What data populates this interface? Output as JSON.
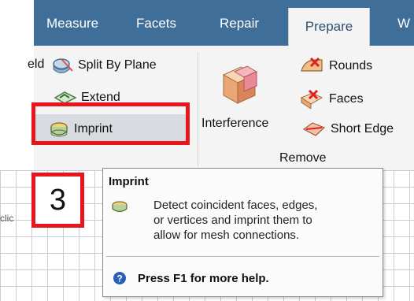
{
  "tabs": [
    {
      "label": "Measure",
      "active": false
    },
    {
      "label": "Facets",
      "active": false
    },
    {
      "label": "Repair",
      "active": false
    },
    {
      "label": "Prepare",
      "active": true
    },
    {
      "label": "W",
      "active": false
    }
  ],
  "ribbon": {
    "weld_label": "eld",
    "split_by_plane_label": "Split By Plane",
    "extend_label": "Extend",
    "imprint_label": "Imprint",
    "interference_label": "Interference",
    "rounds_label": "Rounds",
    "faces_label": "Faces",
    "short_edges_label": "Short Edge",
    "remove_group_label": "Remove"
  },
  "canvas": {
    "truncated_text": "clic"
  },
  "tooltip": {
    "title": "Imprint",
    "description_line1": "Detect coincident faces, edges,",
    "description_line2": "or vertices and imprint them to",
    "description_line3": "allow for mesh connections.",
    "help_text": "Press F1 for more help."
  },
  "annotation": {
    "step_number": "3"
  },
  "colors": {
    "tab_bar": "#3f6e99",
    "ribbon": "#f4f4f4",
    "highlight": "#e8161c",
    "active_tab_text": "#2f4f70"
  }
}
